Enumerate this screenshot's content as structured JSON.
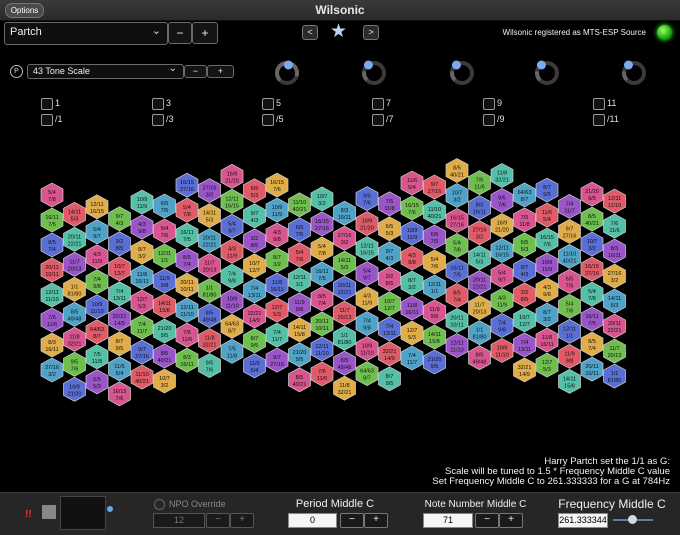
{
  "window": {
    "title": "Wilsonic",
    "options_label": "Options"
  },
  "header": {
    "scale_design": "Partch",
    "nav_prev": "<",
    "nav_next": ">",
    "mts_status": "Wilsonic registered as MTS-ESP Source",
    "minus": "−",
    "plus": "+"
  },
  "scale_row": {
    "p_badge": "P",
    "scale_name": "43 Tone Scale",
    "knobs": [
      0.9,
      0.2,
      0.2,
      0.2,
      0.2
    ]
  },
  "checkboxes": {
    "otonal": [
      "1",
      "3",
      "5",
      "7",
      "9",
      "11"
    ],
    "utonal": [
      "/1",
      "/3",
      "/5",
      "/7",
      "/9",
      "/11"
    ]
  },
  "keyboard": {
    "hexes": [
      [
        "5/4",
        "7/8"
      ],
      [
        "16/11",
        "7/5"
      ],
      [
        "8/5",
        "7/4"
      ],
      [
        "20/11",
        "10/11"
      ],
      [
        "12/11",
        "11/10"
      ],
      [
        "7/6",
        "11/6"
      ],
      [
        "8/3",
        "16/11"
      ],
      [
        "27/16",
        "3/2"
      ],
      [
        "14/11",
        "5/3"
      ],
      [
        "20/11",
        "22/21"
      ],
      [
        "11/7",
        "20/13"
      ],
      [
        "1/1",
        "81/80"
      ],
      [
        "8/5",
        "49/48"
      ],
      [
        "11/8",
        "32/21"
      ],
      [
        "9/5",
        "7/6"
      ],
      [
        "16/9",
        "21/20"
      ],
      [
        "12/11",
        "16/15"
      ],
      [
        "5/4",
        "9/7"
      ],
      [
        "4/3",
        "11/9"
      ],
      [
        "7/4",
        "9/8"
      ],
      [
        "10/9",
        "11/10"
      ],
      [
        "64/63",
        "8/7"
      ],
      [
        "7/5",
        "11/8"
      ],
      [
        "6/5",
        "5/3"
      ],
      [
        "9/7",
        "4/3"
      ],
      [
        "3/2",
        "8/5"
      ],
      [
        "10/7",
        "12/7"
      ],
      [
        "7/4",
        "13/11"
      ],
      [
        "32/21",
        "14/9"
      ],
      [
        "8/7",
        "9/5"
      ],
      [
        "11/6",
        "5/4"
      ],
      [
        "16/15",
        "7/6"
      ],
      [
        "10/9",
        "11/9"
      ],
      [
        "4/3",
        "9/8"
      ],
      [
        "8/7",
        "3/2"
      ],
      [
        "11/8",
        "16/11"
      ],
      [
        "12/7",
        "5/3"
      ],
      [
        "7/4",
        "11/7"
      ],
      [
        "9/7",
        "27/16"
      ],
      [
        "11/10",
        "40/21"
      ],
      [
        "6/5",
        "7/5"
      ],
      [
        "5/4",
        "7/6"
      ],
      [
        "12/11",
        "1/1"
      ],
      [
        "11/9",
        "9/8"
      ],
      [
        "14/11",
        "15/8"
      ],
      [
        "21/20",
        "9/5"
      ],
      [
        "8/5",
        "40/21"
      ],
      [
        "10/7",
        "3/2"
      ],
      [
        "16/15",
        "27/16"
      ]
    ],
    "hex_colors": [
      "#d9558f",
      "#e05a68",
      "#e0ad49",
      "#6fbf4f",
      "#55c0a8",
      "#4fa3c9",
      "#5a6fd6",
      "#9a55c9"
    ]
  },
  "info": {
    "line1": "Harry Partch set the 1/1 as G:",
    "line2": "Scale will be tuned to 1.5 * Frequency Middle C value",
    "line3": "Set Frequency Middle C to 261.333333 for a G at 784Hz"
  },
  "bottom": {
    "red_mark": "!!",
    "npo_label": "NPO Override",
    "npo_value": "12",
    "period_label": "Period Middle C",
    "period_value": "0",
    "note_label": "Note Number Middle C",
    "note_value": "71",
    "freq_label": "Frequency Middle C",
    "freq_value": "261.333344"
  }
}
